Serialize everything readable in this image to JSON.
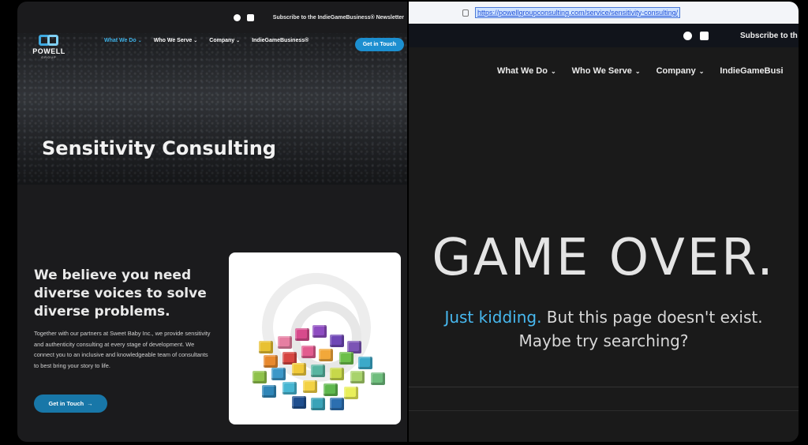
{
  "left": {
    "topbar": {
      "icons": [
        "facebook-icon",
        "linkedin-icon"
      ],
      "newsletter": "Subscribe to the IndieGameBusiness® Newsletter"
    },
    "logo": {
      "name": "POWELL",
      "sub": "GROUP"
    },
    "nav": [
      {
        "label": "What We Do",
        "active": true
      },
      {
        "label": "Who We Serve",
        "active": false
      },
      {
        "label": "Company",
        "active": false
      },
      {
        "label": "IndieGameBusiness®",
        "active": false
      }
    ],
    "nav_cta": "Get in Touch",
    "hero_title": "Sensitivity Consulting",
    "heading": "We believe you need diverse voices to solve diverse problems.",
    "paragraph": "Together with our partners at Sweet Baby Inc., we provide sensitivity and authenticity consulting at every stage of development. We connect you to an inclusive and knowledgeable team of consultants to best bring your story to life.",
    "cta": "Get in Touch",
    "cta_arrow": "→",
    "colors": {
      "accent": "#3fb1e6",
      "button": "#1877a8",
      "background": "#1b1b1d"
    }
  },
  "right": {
    "url": "https://powellgroupconsulting.com/service/sensitivity-consulting/",
    "topbar": {
      "icons": [
        "facebook-icon",
        "linkedin-icon"
      ],
      "newsletter": "Subscribe to th"
    },
    "nav": [
      {
        "label": "What We Do"
      },
      {
        "label": "Who We Serve"
      },
      {
        "label": "Company"
      },
      {
        "label": "IndieGameBusi"
      }
    ],
    "title": "GAME OVER.",
    "kidding": "Just kidding.",
    "message_rest": " But this page doesn't exist.",
    "message_line2": "Maybe try searching?",
    "colors": {
      "accent": "#47b8ef",
      "background": "#1a1a1a"
    }
  }
}
